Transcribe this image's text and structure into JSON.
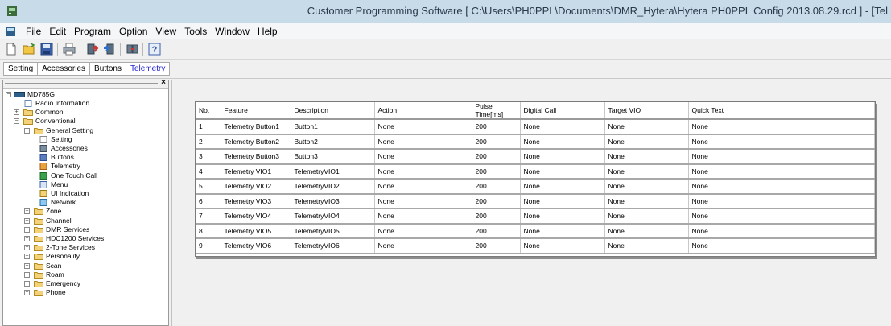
{
  "window": {
    "title": "Customer Programming Software [ C:\\Users\\PH0PPL\\Documents\\DMR_Hytera\\Hytera PH0PPL Config 2013.08.29.rcd ] - [Tel"
  },
  "menu": {
    "items": [
      "File",
      "Edit",
      "Program",
      "Option",
      "View",
      "Tools",
      "Window",
      "Help"
    ]
  },
  "toolbar": {
    "buttons": [
      "new-icon",
      "open-icon",
      "save-icon",
      "print-icon",
      "read-icon",
      "write-icon",
      "clone-icon",
      "help-icon"
    ]
  },
  "tabs": {
    "items": [
      "Setting",
      "Accessories",
      "Buttons",
      "Telemetry"
    ],
    "active": "Telemetry"
  },
  "tree": {
    "root": "MD785G",
    "nodes": [
      {
        "label": "Radio Information",
        "level": 1,
        "icon": "doc-icon"
      },
      {
        "label": "Common",
        "level": 1,
        "icon": "folder-icon",
        "expander": "+"
      },
      {
        "label": "Conventional",
        "level": 1,
        "icon": "folder-icon",
        "expander": "-"
      },
      {
        "label": "General Setting",
        "level": 2,
        "icon": "folder-icon",
        "expander": "-"
      },
      {
        "label": "Setting",
        "level": 3,
        "icon": "wrench-icon"
      },
      {
        "label": "Accessories",
        "level": 3,
        "icon": "accessory-icon"
      },
      {
        "label": "Buttons",
        "level": 3,
        "icon": "buttons-icon"
      },
      {
        "label": "Telemetry",
        "level": 3,
        "icon": "telemetry-icon"
      },
      {
        "label": "One Touch Call",
        "level": 3,
        "icon": "call-icon"
      },
      {
        "label": "Menu",
        "level": 3,
        "icon": "menu-icon"
      },
      {
        "label": "UI Indication",
        "level": 3,
        "icon": "ui-icon"
      },
      {
        "label": "Network",
        "level": 3,
        "icon": "network-icon"
      },
      {
        "label": "Zone",
        "level": 2,
        "icon": "folder-icon",
        "expander": "+"
      },
      {
        "label": "Channel",
        "level": 2,
        "icon": "folder-icon",
        "expander": "+"
      },
      {
        "label": "DMR Services",
        "level": 2,
        "icon": "folder-icon",
        "expander": "+"
      },
      {
        "label": "HDC1200 Services",
        "level": 2,
        "icon": "folder-icon",
        "expander": "+"
      },
      {
        "label": "2-Tone Services",
        "level": 2,
        "icon": "folder-icon",
        "expander": "+"
      },
      {
        "label": "Personality",
        "level": 2,
        "icon": "folder-icon",
        "expander": "+"
      },
      {
        "label": "Scan",
        "level": 2,
        "icon": "folder-icon",
        "expander": "+"
      },
      {
        "label": "Roam",
        "level": 2,
        "icon": "folder-icon",
        "expander": "+"
      },
      {
        "label": "Emergency",
        "level": 2,
        "icon": "folder-icon",
        "expander": "+"
      },
      {
        "label": "Phone",
        "level": 2,
        "icon": "folder-icon",
        "expander": "+"
      }
    ]
  },
  "grid": {
    "columns": [
      "No.",
      "Feature",
      "Description",
      "Action",
      "Pulse Time[ms]",
      "Digital Call",
      "Target VIO",
      "Quick Text"
    ],
    "rows": [
      [
        "1",
        "Telemetry Button1",
        "Button1",
        "None",
        "200",
        "None",
        "None",
        "None"
      ],
      [
        "2",
        "Telemetry Button2",
        "Button2",
        "None",
        "200",
        "None",
        "None",
        "None"
      ],
      [
        "3",
        "Telemetry Button3",
        "Button3",
        "None",
        "200",
        "None",
        "None",
        "None"
      ],
      [
        "4",
        "Telemetry VIO1",
        "TelemetryVIO1",
        "None",
        "200",
        "None",
        "None",
        "None"
      ],
      [
        "5",
        "Telemetry VIO2",
        "TelemetryVIO2",
        "None",
        "200",
        "None",
        "None",
        "None"
      ],
      [
        "6",
        "Telemetry VIO3",
        "TelemetryVIO3",
        "None",
        "200",
        "None",
        "None",
        "None"
      ],
      [
        "7",
        "Telemetry VIO4",
        "TelemetryVIO4",
        "None",
        "200",
        "None",
        "None",
        "None"
      ],
      [
        "8",
        "Telemetry VIO5",
        "TelemetryVIO5",
        "None",
        "200",
        "None",
        "None",
        "None"
      ],
      [
        "9",
        "Telemetry VIO6",
        "TelemetryVIO6",
        "None",
        "200",
        "None",
        "None",
        "None"
      ]
    ]
  }
}
